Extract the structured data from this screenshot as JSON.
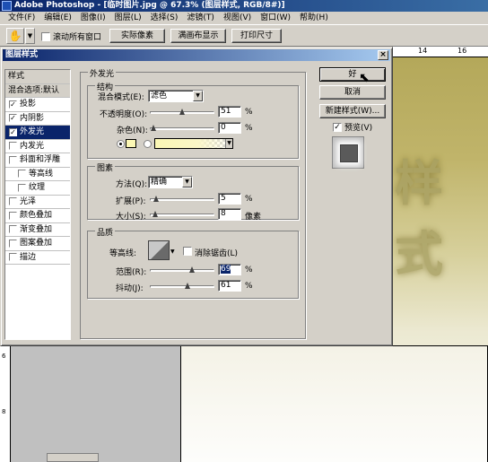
{
  "app": {
    "title": "Adobe Photoshop - [临时图片.jpg @ 67.3% (图层样式, RGB/8#)]"
  },
  "menu": [
    "文件(F)",
    "编辑(E)",
    "图像(I)",
    "图层(L)",
    "选择(S)",
    "滤镜(T)",
    "视图(V)",
    "窗口(W)",
    "帮助(H)"
  ],
  "options": {
    "scroll_all_label": "滚动所有窗口",
    "actual_pixels": "实际像素",
    "fit_screen": "满画布显示",
    "print_size": "打印尺寸"
  },
  "ruler": {
    "top": [
      "14",
      "16"
    ],
    "left": [
      "6",
      "8"
    ]
  },
  "document": {
    "text": "样式"
  },
  "dialog": {
    "title": "图层样式",
    "close": "×",
    "style_list": {
      "header": "样式",
      "blend_default": "混合选项:默认",
      "items": [
        {
          "label": "投影",
          "checked": true
        },
        {
          "label": "内阴影",
          "checked": true
        },
        {
          "label": "外发光",
          "checked": true,
          "selected": true
        },
        {
          "label": "内发光",
          "checked": false
        },
        {
          "label": "斜面和浮雕",
          "checked": false
        },
        {
          "label": "等高线",
          "checked": false,
          "indent": true
        },
        {
          "label": "纹理",
          "checked": false,
          "indent": true
        },
        {
          "label": "光泽",
          "checked": false
        },
        {
          "label": "颜色叠加",
          "checked": false
        },
        {
          "label": "渐变叠加",
          "checked": false
        },
        {
          "label": "图案叠加",
          "checked": false
        },
        {
          "label": "描边",
          "checked": false
        }
      ]
    },
    "outer_glow": {
      "title": "外发光",
      "structure": {
        "title": "结构",
        "blend_mode_label": "混合模式(E):",
        "blend_mode_value": "滤色",
        "opacity_label": "不透明度(O):",
        "opacity_value": "51",
        "opacity_fraction": 0.51,
        "noise_label": "杂色(N):",
        "noise_value": "0",
        "noise_fraction": 0,
        "unit": "%",
        "glow_color": "#fbf7b4"
      },
      "elements": {
        "title": "图素",
        "technique_label": "方法(Q):",
        "technique_value": "精确",
        "spread_label": "扩展(P):",
        "spread_value": "5",
        "spread_fraction": 0.05,
        "size_label": "大小(S):",
        "size_value": "8",
        "size_fraction": 0.03,
        "percent": "%",
        "px_unit": "像素"
      },
      "quality": {
        "title": "品质",
        "contour_label": "等高线:",
        "antialias_label": "消除锯齿(L)",
        "range_label": "范围(R):",
        "range_value": "69",
        "range_fraction": 0.69,
        "jitter_label": "抖动(J):",
        "jitter_value": "61",
        "jitter_fraction": 0.61,
        "unit": "%"
      }
    },
    "buttons": {
      "ok": "好",
      "cancel": "取消",
      "new_style": "新建样式(W)...",
      "preview": "预览(V)"
    }
  }
}
